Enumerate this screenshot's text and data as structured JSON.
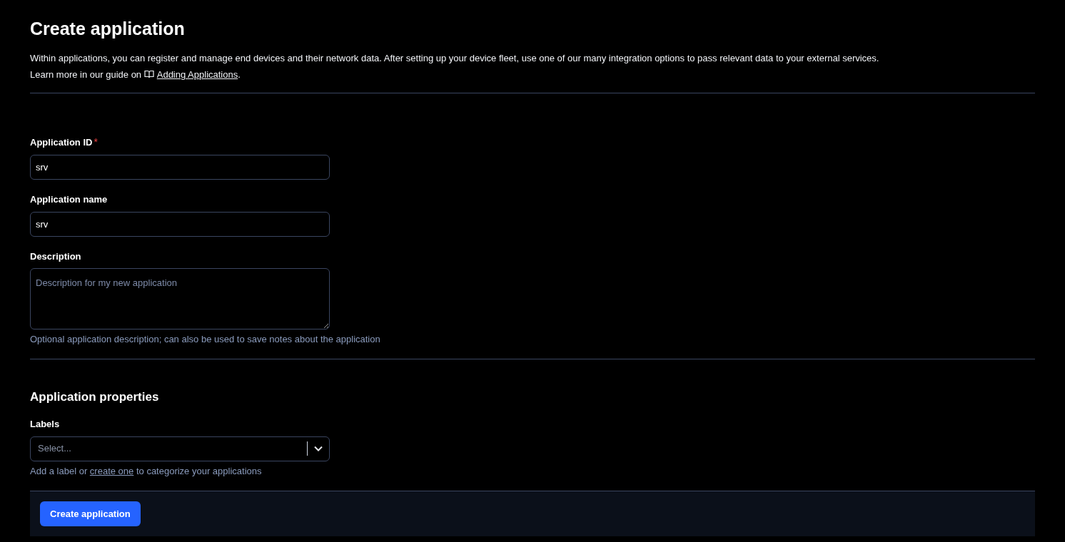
{
  "page": {
    "title": "Create application",
    "intro": "Within applications, you can register and manage end devices and their network data. After setting up your device fleet, use one of our many integration options to pass relevant data to your external services.",
    "guide": {
      "prefix": "Learn more in our guide on",
      "link": "Adding Applications",
      "suffix": "."
    }
  },
  "fields": [
    {
      "kind": "text",
      "label": "Application ID",
      "required_mark": "*",
      "value": "srv"
    },
    {
      "kind": "text",
      "label": "Application name",
      "value": "srv"
    },
    {
      "kind": "textarea",
      "label": "Description",
      "placeholder": "Description for my new application",
      "hint": {
        "text": "Optional application description; can also be used to save notes about the application"
      }
    }
  ],
  "properties": {
    "title": "Application properties",
    "fields": [
      {
        "kind": "select",
        "label": "Labels",
        "placeholder": "Select...",
        "hint": {
          "prefix": "Add a label or",
          "link": "create one",
          "suffix": "to categorize your applications"
        }
      }
    ]
  },
  "submit": {
    "label": "Create application"
  }
}
